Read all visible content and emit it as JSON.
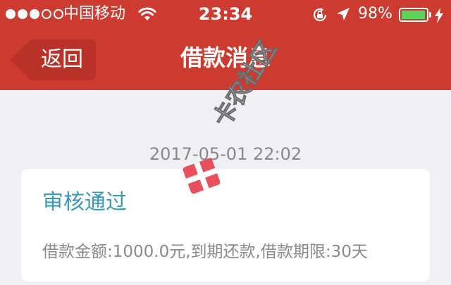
{
  "status_bar": {
    "signal_full": 3,
    "signal_total": 5,
    "carrier": "中国移动",
    "time": "23:34",
    "battery_percent": "98%",
    "battery_level": 0.98,
    "icons": [
      "wifi-icon",
      "orientation-lock-icon",
      "location-arrow-icon",
      "battery-icon",
      "charging-bolt-icon"
    ]
  },
  "nav": {
    "back_label": "返回",
    "title": "借款消息"
  },
  "message": {
    "timestamp": "2017-05-01 22:02",
    "title": "审核通过",
    "body": "借款金额:1000.0元,到期还款,借款期限:30天"
  },
  "watermark": {
    "text": "卡农社区",
    "icon": "gift-logo-icon"
  },
  "colors": {
    "header_bg": "#cc3a30",
    "page_bg": "#efeff4",
    "card_bg": "#ffffff",
    "title_accent": "#3a9ab8",
    "muted_text": "#8a8a8a",
    "battery_green": "#5ed35c"
  }
}
